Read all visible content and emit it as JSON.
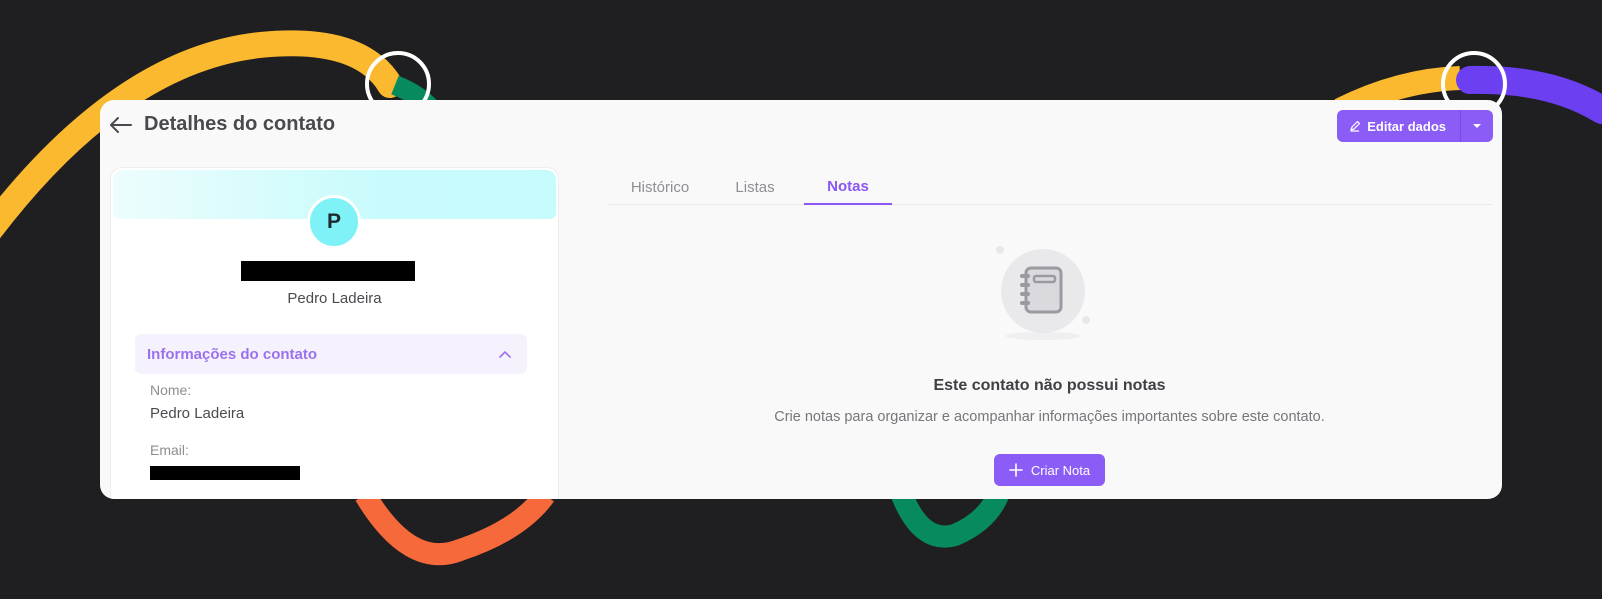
{
  "header": {
    "back_icon": "arrow-left-icon",
    "title": "Detalhes do contato",
    "edit_label": "Editar dados",
    "edit_icon": "pencil-icon",
    "dropdown_icon": "caret-down-icon"
  },
  "contact": {
    "avatar_letter": "P",
    "name": "Pedro Ladeira"
  },
  "info_section": {
    "title": "Informações do contato",
    "toggle_icon": "chevron-up-icon",
    "fields": [
      {
        "label": "Nome:",
        "value": "Pedro Ladeira"
      },
      {
        "label": "Email:",
        "value": ""
      }
    ]
  },
  "tabs": [
    {
      "label": "Histórico",
      "active": false
    },
    {
      "label": "Listas",
      "active": false
    },
    {
      "label": "Notas",
      "active": true
    }
  ],
  "empty_state": {
    "icon": "notebook-icon",
    "title": "Este contato não possui notas",
    "description": "Crie notas para organizar e acompanhar informações importantes sobre este contato.",
    "button_label": "Criar Nota",
    "button_icon": "plus-icon"
  },
  "colors": {
    "accent": "#8c5cf6",
    "avatar_bg": "#7ef2f6",
    "page_bg": "#1f1e21"
  }
}
